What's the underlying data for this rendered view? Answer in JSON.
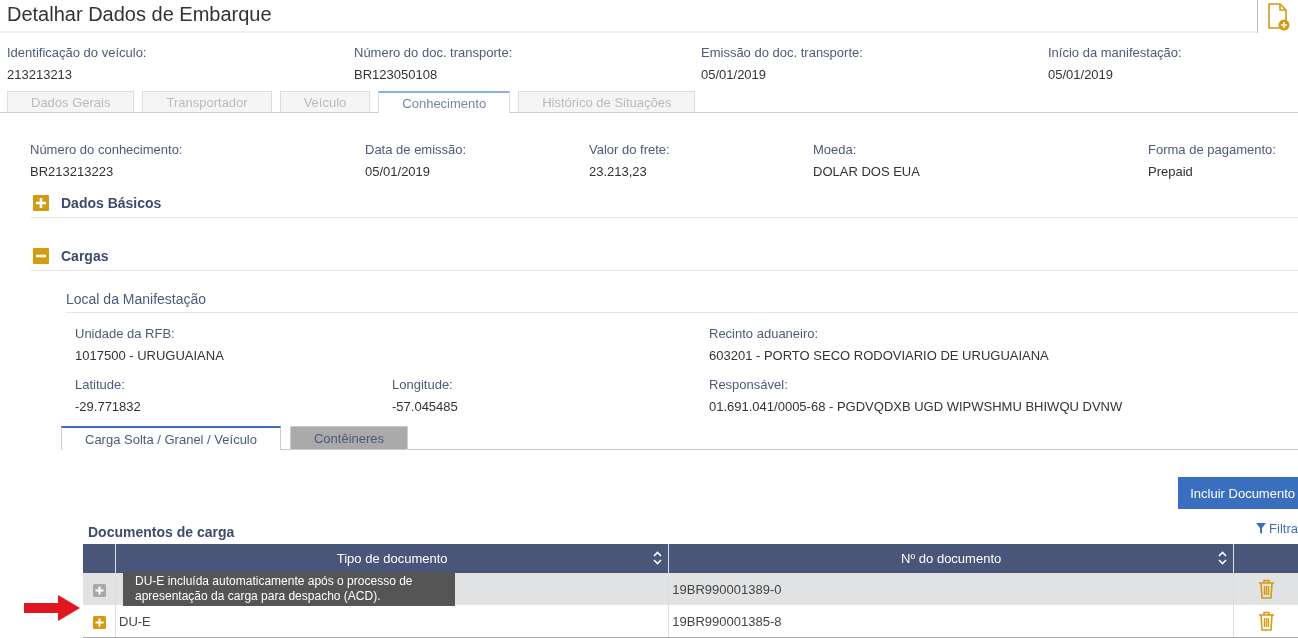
{
  "page": {
    "title": "Detalhar Dados de Embarque"
  },
  "summary": [
    {
      "label": "Identificação do veículo:",
      "value": "213213213"
    },
    {
      "label": "Número do doc. transporte:",
      "value": "BR123050108"
    },
    {
      "label": "Emissão do doc. transporte:",
      "value": "05/01/2019"
    },
    {
      "label": "Início da manifestação:",
      "value": "05/01/2019"
    }
  ],
  "tabs": [
    {
      "label": "Dados Gerais",
      "selected": false
    },
    {
      "label": "Transportador",
      "selected": false
    },
    {
      "label": "Veículo",
      "selected": false
    },
    {
      "label": "Conhecimento",
      "selected": true
    },
    {
      "label": "Histórico de Situações",
      "selected": false
    }
  ],
  "conhecimento": [
    {
      "label": "Número do conhecimento:",
      "value": "BR213213223"
    },
    {
      "label": "Data de emissão:",
      "value": "05/01/2019"
    },
    {
      "label": "Valor do frete:",
      "value": "23.213,23"
    },
    {
      "label": "Moeda:",
      "value": "DOLAR DOS EUA"
    },
    {
      "label": "Forma de pagamento:",
      "value": "Prepaid"
    }
  ],
  "sections": [
    {
      "title": "Dados Básicos",
      "expanded": false
    },
    {
      "title": "Cargas",
      "expanded": true
    }
  ],
  "local": {
    "title": "Local da Manifestação",
    "fields": [
      {
        "label": "Unidade da RFB:",
        "value": "1017500 - URUGUAIANA"
      },
      {
        "label": "Recinto aduaneiro:",
        "value": "603201 - PORTO SECO RODOVIARIO DE URUGUAIANA"
      },
      {
        "label": "Latitude:",
        "value": "-29.771832"
      },
      {
        "label": "Longitude:",
        "value": "-57.045485"
      },
      {
        "label": "Responsável:",
        "value": "01.691.041/0005-68 - PGDVQDXB UGD WIPWSHMU BHIWQU DVNW"
      }
    ]
  },
  "subtabs": [
    {
      "label": "Carga Solta / Granel / Veículo",
      "selected": true
    },
    {
      "label": "Contêineres",
      "selected": false
    }
  ],
  "add_button": "Incluir Documento",
  "documents": {
    "title": "Documentos de carga",
    "filter": "Filtra",
    "columns": [
      "Tipo de documento",
      "Nº do documento"
    ],
    "rows": [
      {
        "number": "19BR990001389-0",
        "selected": true,
        "disabled": true
      },
      {
        "type": "DU-E",
        "number": "19BR990001385-8",
        "selected": false,
        "disabled": false
      }
    ],
    "tooltip": "DU-E incluída automaticamente após o processo de apresentação da carga para despacho (ACD)."
  }
}
